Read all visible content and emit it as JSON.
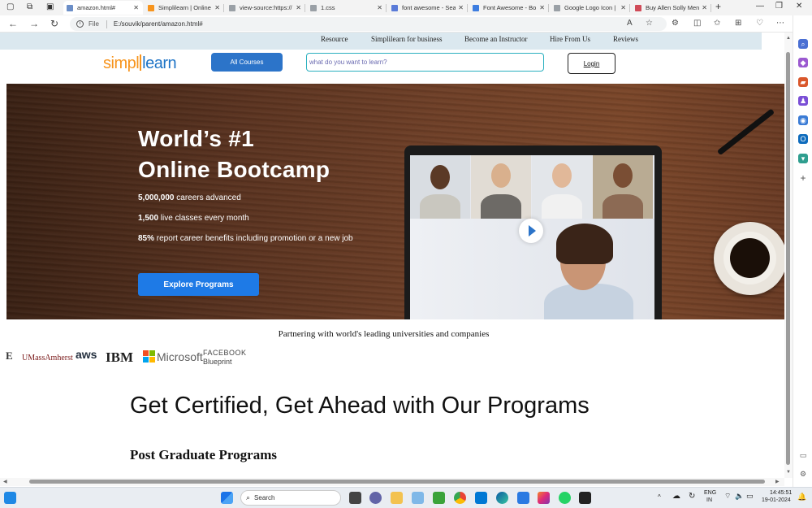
{
  "browser": {
    "tabs": [
      {
        "label": "amazon.html#",
        "active": true,
        "color": "#6b8ec7"
      },
      {
        "label": "Simplilearn | Online",
        "active": false,
        "color": "#f7941d"
      },
      {
        "label": "view-source:https://",
        "active": false,
        "color": "#9aa0a6"
      },
      {
        "label": "1.css",
        "active": false,
        "color": "#9aa0a6"
      },
      {
        "label": "font awesome - Sea",
        "active": false,
        "color": "#5a7bd8"
      },
      {
        "label": "Font Awesome - Bo",
        "active": false,
        "color": "#3d7de0"
      },
      {
        "label": "Google Logo Icon |",
        "active": false,
        "color": "#9aa0a6"
      },
      {
        "label": "Buy Allen Solly Men",
        "active": false,
        "color": "#d04b58"
      }
    ],
    "address": {
      "scheme_label": "File",
      "url": "E:/souvik/parent/amazon.html#"
    }
  },
  "page": {
    "topnav": [
      "Resource",
      "Simplilearn for business",
      "Become an Instructor",
      "Hire From Us",
      "Reviews"
    ],
    "logo": {
      "part1": "simpl",
      "part2": "learn"
    },
    "all_courses_label": "All Courses",
    "search_placeholder": "what do you want to learn?",
    "login_label": "Login",
    "hero": {
      "title_line1": "World’s #1",
      "title_line2": "Online Bootcamp",
      "stats": [
        {
          "bold": "5,000,000",
          "text": " careers advanced"
        },
        {
          "bold": "1,500",
          "text": " live classes every month"
        },
        {
          "bold": "85%",
          "text": " report career benefits including promotion or a new job"
        }
      ],
      "cta_label": "Explore Programs"
    },
    "partners_text": "Partnering with world's leading universities and companies",
    "partner_logos": [
      "E",
      "UMassAmherst",
      "aws",
      "IBM",
      "Microsoft",
      "FACEBOOK",
      "Blueprint"
    ],
    "section_title": "Get Certified, Get Ahead with Our Programs",
    "sub_title": "Post Graduate Programs"
  },
  "taskbar": {
    "search_label": "Search",
    "language": "ENG",
    "region": "IN",
    "time": "14:45:51",
    "date": "19-01-2024"
  }
}
